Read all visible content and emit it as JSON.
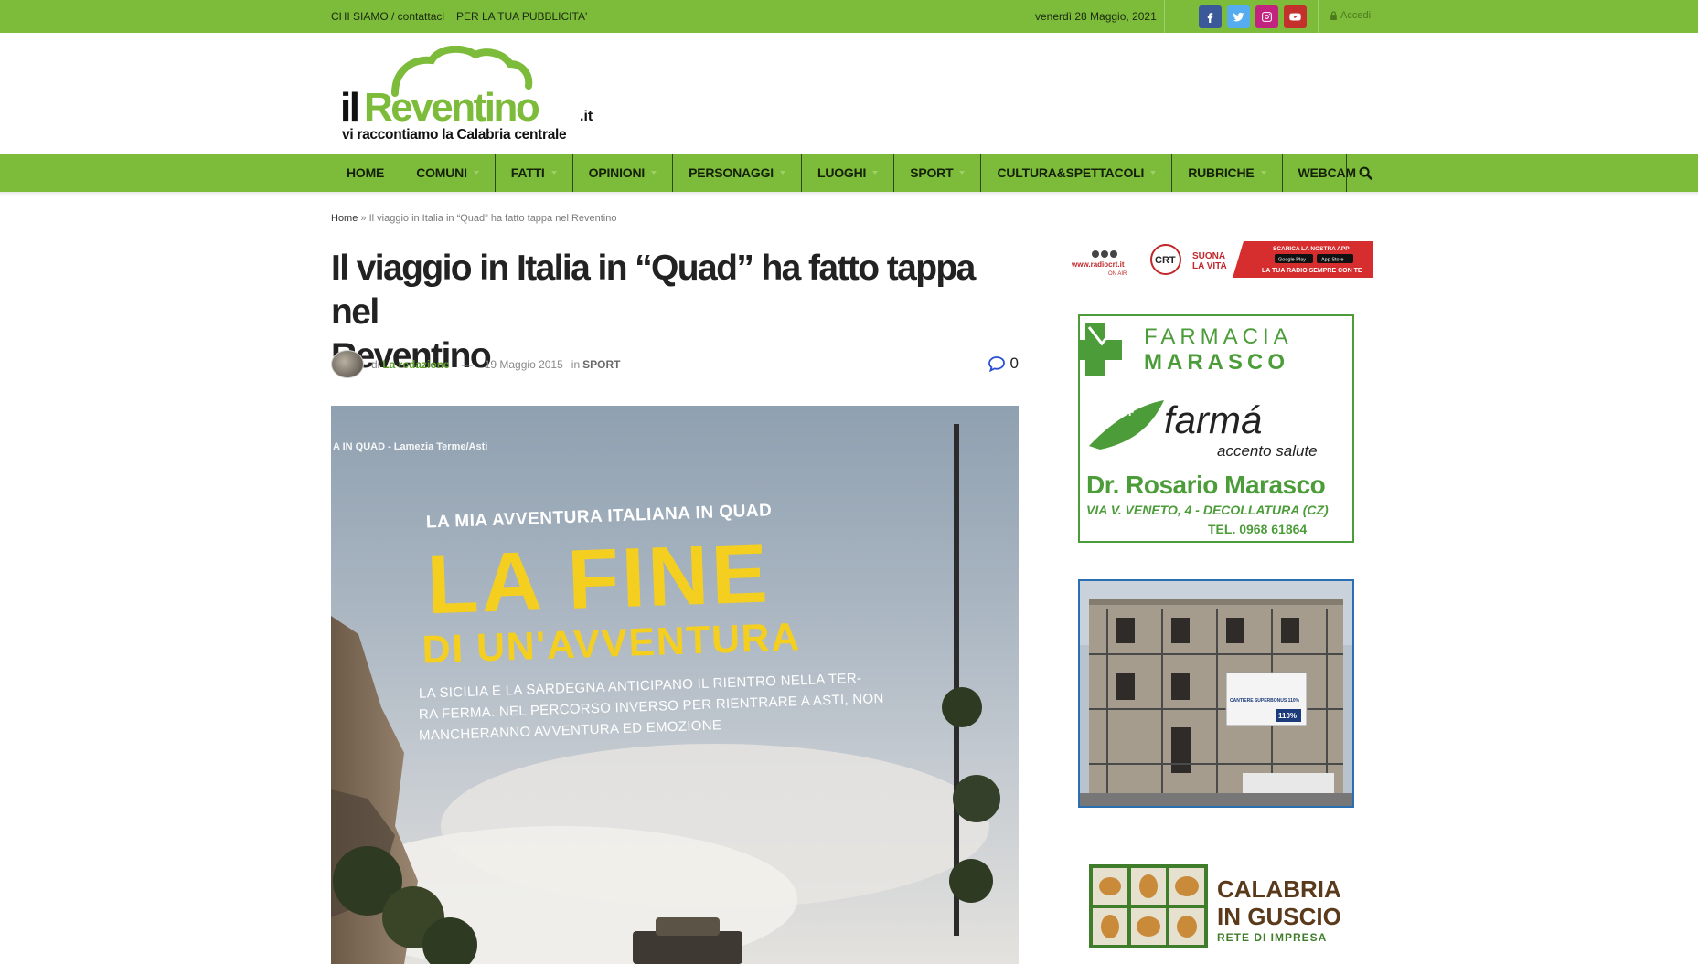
{
  "topbar": {
    "links": [
      "CHI SIAMO / contattaci",
      "PER LA TUA PUBBLICITA'"
    ],
    "date": "venerdì 28 Maggio, 2021",
    "social": [
      {
        "name": "facebook",
        "color": "#3b5998"
      },
      {
        "name": "twitter",
        "color": "#55acee"
      },
      {
        "name": "instagram",
        "color": "#c2237f"
      },
      {
        "name": "youtube",
        "color": "#c4302b"
      }
    ],
    "login": "Accedi"
  },
  "logo": {
    "brand_il": "il",
    "brand_name": "Reventino",
    "brand_tld": ".it",
    "tagline": "vi raccontiamo la Calabria centrale",
    "brand_color": "#7dbb3a"
  },
  "nav": {
    "items": [
      {
        "label": "HOME",
        "dropdown": false
      },
      {
        "label": "COMUNI",
        "dropdown": true
      },
      {
        "label": "FATTI",
        "dropdown": true
      },
      {
        "label": "OPINIONI",
        "dropdown": true
      },
      {
        "label": "PERSONAGGI",
        "dropdown": true
      },
      {
        "label": "LUOGHI",
        "dropdown": true
      },
      {
        "label": "SPORT",
        "dropdown": true
      },
      {
        "label": "CULTURA&SPETTACOLI",
        "dropdown": true
      },
      {
        "label": "RUBRICHE",
        "dropdown": true
      },
      {
        "label": "WEBCAM",
        "dropdown": true
      }
    ],
    "search_icon": "search-icon",
    "color": "#7dbb3a"
  },
  "breadcrumb": {
    "home": "Home",
    "separator": "»",
    "current": "Il viaggio in Italia in “Quad” ha fatto tappa nel Reventino"
  },
  "article": {
    "title_line1": "Il viaggio in Italia in “Quad” ha fatto tappa nel",
    "title_line2": "Reventino",
    "by_prefix": "di",
    "author": "La redazione",
    "date": "19 Maggio 2015",
    "in_prefix": "in",
    "category": "SPORT",
    "comments_count": "0",
    "image": {
      "header_text": "A IN QUAD - Lamezia Terme/Asti",
      "kicker": "LA MIA AVVENTURA ITALIANA IN QUAD",
      "headline_1": "LA FINE",
      "headline_2": "DI UN'AVVENTURA",
      "body_1": "LA SICILIA E LA SARDEGNA ANTICIPANO IL RIENTRO NELLA TER-",
      "body_2": "RA FERMA. NEL PERCORSO INVERSO PER RIENTRARE A ASTI, NON",
      "body_3": "MANCHERANNO AVVENTURA ED EMOZIONE"
    }
  },
  "sidebar": {
    "radio_ad": {
      "site": "www.radiocrt.it",
      "on_air": "ON AIR",
      "crt": "CRT",
      "slogan_1": "SUONA",
      "slogan_2": "LA VITA",
      "app_line": "SCARICA LA NOSTRA APP",
      "store_1": "Google Play",
      "store_2": "App Store",
      "footer": "LA TUA RADIO SEMPRE CON TE"
    },
    "farmacia_ad": {
      "line_1": "FARMACIA",
      "line_2": "MARASCO",
      "brand": "farmá",
      "brand_sub": "accento salute",
      "doctor": "Dr. Rosario Marasco",
      "address": "VIA V. VENETO, 4 - DECOLLATURA (CZ)",
      "phone": "TEL. 0968 61864"
    },
    "cantiere_ad": {
      "sign_1": "CANTIERE SUPERBONUS 110%",
      "sign_2": "110%"
    },
    "calabria_ad": {
      "line_1": "CALABRIA",
      "line_2": "IN GUSCIO",
      "line_3": "RETE DI IMPRESA"
    }
  }
}
